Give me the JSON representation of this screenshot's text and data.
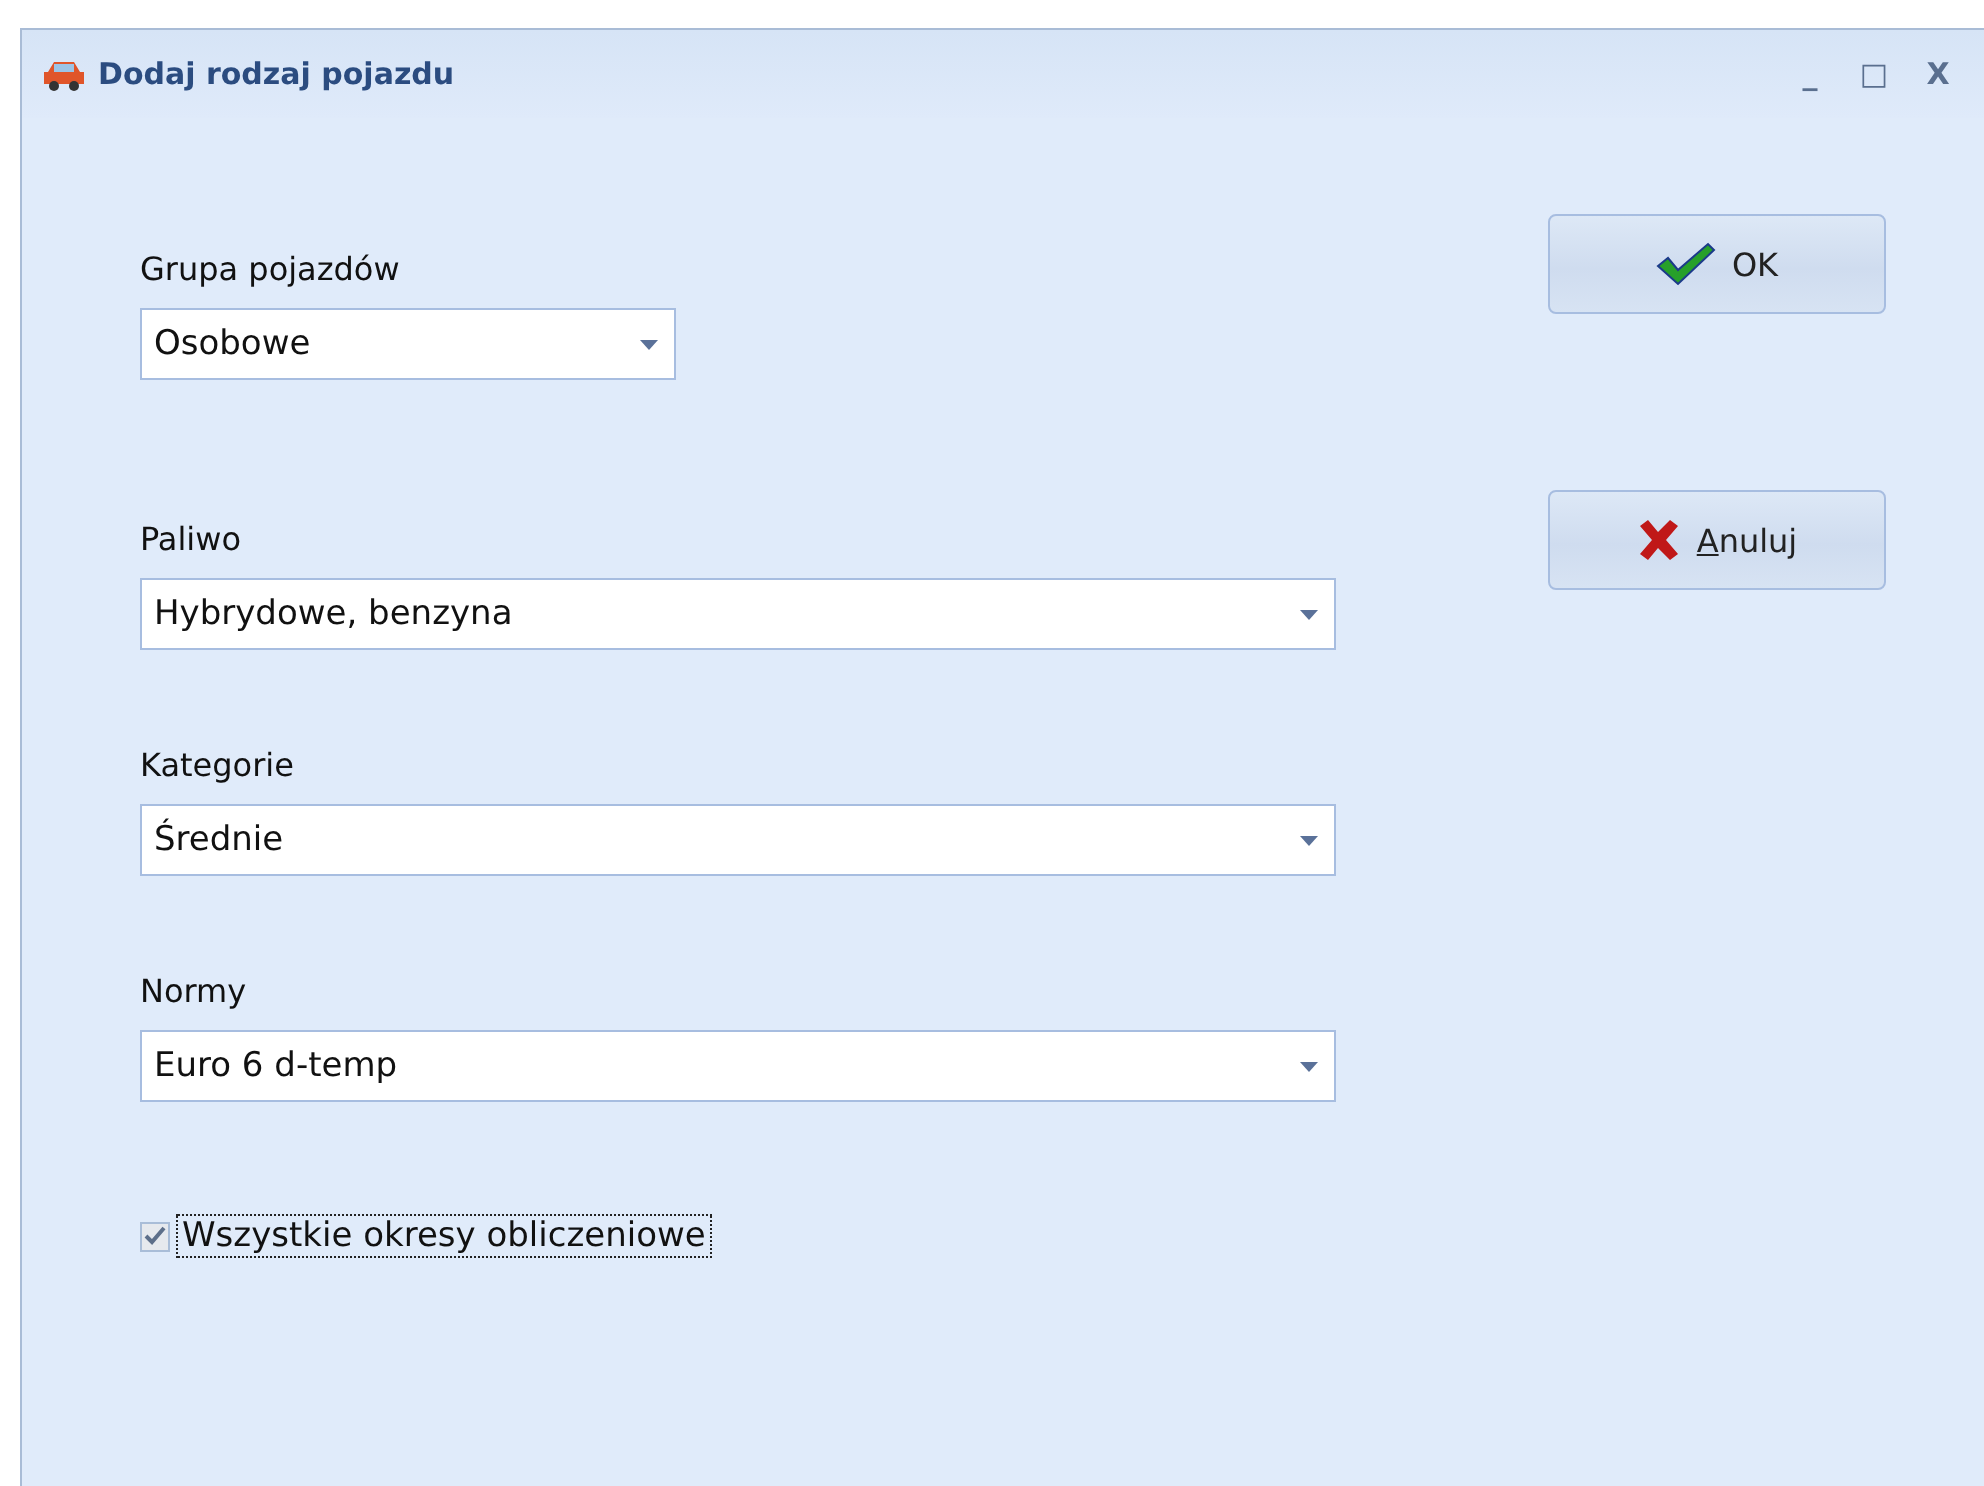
{
  "window": {
    "title": "Dodaj rodzaj pojazdu",
    "controls": [
      "_",
      "□",
      "X"
    ]
  },
  "fields": [
    {
      "label": "Grupa pojazdów",
      "value": "Osobowe"
    },
    {
      "label": "Paliwo",
      "value": "Hybrydowe, benzyna"
    },
    {
      "label": "Kategorie",
      "value": "Średnie"
    },
    {
      "label": "Normy",
      "value": "Euro 6 d-temp"
    }
  ],
  "checkbox": {
    "label": "Wszystkie okresy obliczeniowe",
    "checked": true,
    "focused": true
  },
  "buttons": [
    {
      "kind": "ok",
      "label": "OK"
    },
    {
      "kind": "cancel",
      "label": "Anuluj"
    }
  ]
}
